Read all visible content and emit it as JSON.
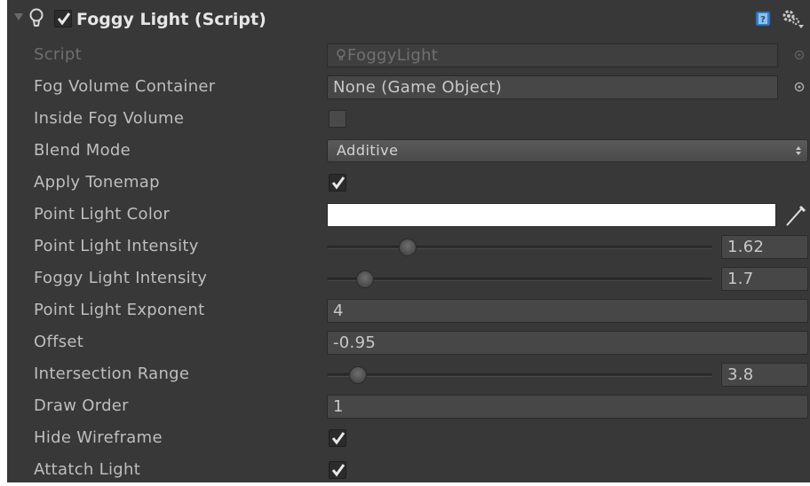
{
  "component": {
    "title": "Foggy Light (Script)",
    "enabled": true,
    "foldout_icon": "triangle-down-icon",
    "component_icon": "light-bulb-icon",
    "help_icon": "help-book-icon",
    "settings_icon": "gear-menu-icon"
  },
  "fields": {
    "script": {
      "label": "Script",
      "value": "FoggyLight",
      "icon": "script-bulb-icon"
    },
    "fog_volume_container": {
      "label": "Fog Volume Container",
      "value": "None (Game Object)"
    },
    "inside_fog_volume": {
      "label": "Inside Fog Volume",
      "checked": false
    },
    "blend_mode": {
      "label": "Blend Mode",
      "value": "Additive"
    },
    "apply_tonemap": {
      "label": "Apply Tonemap",
      "checked": true
    },
    "point_light_color": {
      "label": "Point Light Color",
      "color": "#ffffff"
    },
    "point_light_intensity": {
      "label": "Point Light Intensity",
      "value": "1.62",
      "slider_fraction": 0.21
    },
    "foggy_light_intensity": {
      "label": "Foggy Light Intensity",
      "value": "1.7",
      "slider_fraction": 0.1
    },
    "point_light_exponent": {
      "label": "Point Light Exponent",
      "value": "4"
    },
    "offset": {
      "label": "Offset",
      "value": "-0.95"
    },
    "intersection_range": {
      "label": "Intersection Range",
      "value": "3.8",
      "slider_fraction": 0.08
    },
    "draw_order": {
      "label": "Draw Order",
      "value": "1"
    },
    "hide_wireframe": {
      "label": "Hide Wireframe",
      "checked": true
    },
    "attatch_light": {
      "label": "Attatch Light",
      "checked": true
    }
  },
  "colors": {
    "panel_bg": "#383838",
    "label_text": "#bebebe",
    "field_bg": "#474747",
    "help_icon_blue": "#3b7fc4"
  }
}
